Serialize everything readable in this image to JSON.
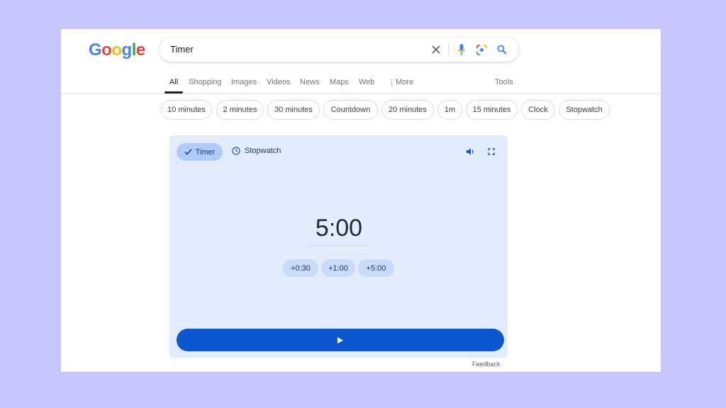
{
  "logo": "Google",
  "search": {
    "value": "Timer"
  },
  "tabs": [
    "All",
    "Shopping",
    "Images",
    "Videos",
    "News",
    "Maps",
    "Web",
    "More"
  ],
  "tools": "Tools",
  "chips": [
    "10 minutes",
    "2 minutes",
    "30 minutes",
    "Countdown",
    "20 minutes",
    "1m",
    "15 minutes",
    "Clock",
    "Stopwatch"
  ],
  "timer": {
    "tab_timer": "Timer",
    "tab_stopwatch": "Stopwatch",
    "time": "5:00",
    "add": [
      "+0:30",
      "+1:00",
      "+5:00"
    ]
  },
  "feedback": "Feedback",
  "colors": {
    "accent": "#0b57d0",
    "card": "#e3ebfc",
    "background": "#c7c5fb"
  }
}
